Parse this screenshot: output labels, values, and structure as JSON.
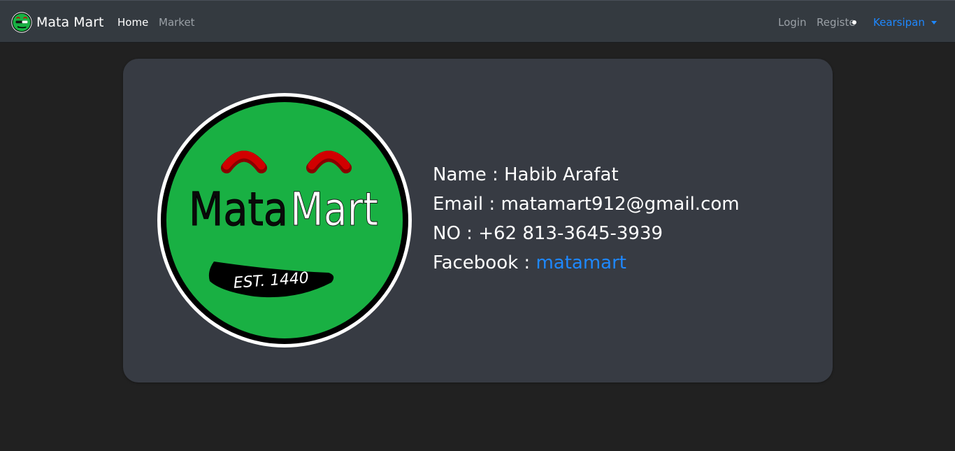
{
  "navbar": {
    "brand": "Mata Mart",
    "links": {
      "home": "Home",
      "market": "Market",
      "login": "Login",
      "register": "Register",
      "dropdown": "Kearsipan"
    }
  },
  "logo": {
    "word_dark": "Mata",
    "word_light": "Mart",
    "established": "EST. 1440"
  },
  "profile": {
    "name_label": "Name : ",
    "name": "Habib Arafat",
    "email_label": "Email : ",
    "email": "matamart912@gmail.com",
    "phone_label": "NO : ",
    "phone": "+62 813-3645-3939",
    "facebook_label": "Facebook : ",
    "facebook": "matamart"
  },
  "colors": {
    "navbar_bg": "#343a40",
    "page_bg": "#212121",
    "card_bg": "#373b43",
    "link_blue": "#1e88ff",
    "logo_green": "#19b043",
    "logo_red": "#d10000"
  }
}
